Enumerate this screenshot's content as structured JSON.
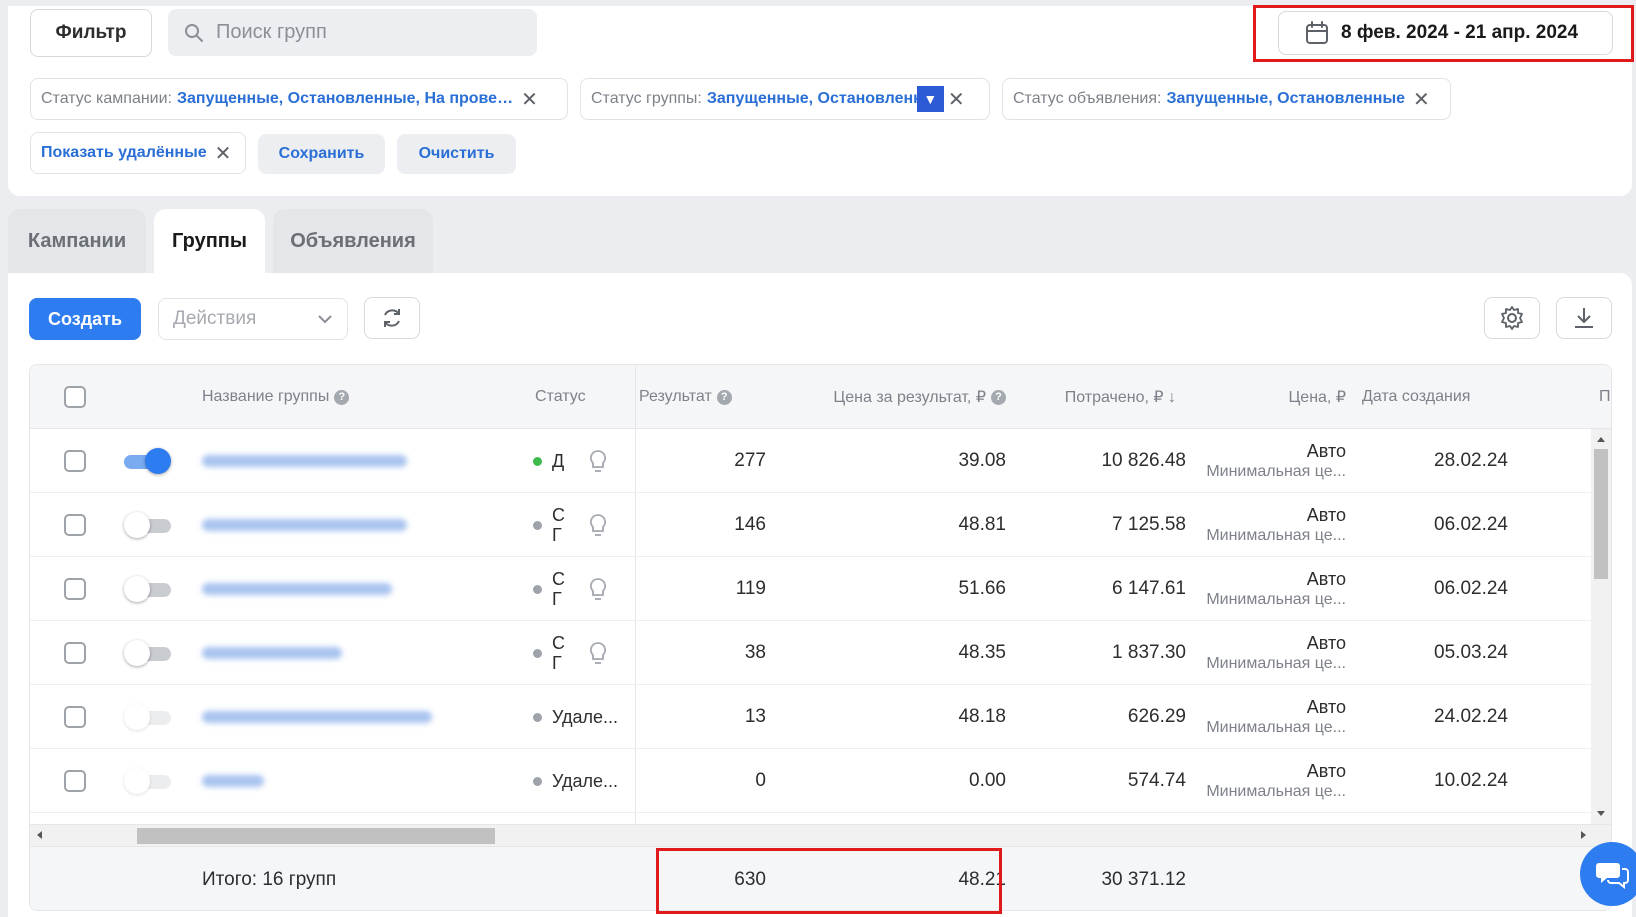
{
  "toolbar": {
    "filter_label": "Фильтр",
    "search_placeholder": "Поиск групп",
    "date_range": "8 фев. 2024 - 21 апр. 2024"
  },
  "filters": {
    "campaign_status_key": "Статус кампании:",
    "campaign_status_value": "Запущенные, Остановленные, На прове…",
    "group_status_key": "Статус группы:",
    "group_status_value": "Запущенные, Остановленн",
    "ad_status_key": "Статус объявления:",
    "ad_status_value": "Запущенные, Остановленные",
    "show_deleted": "Показать удалённые",
    "save": "Сохранить",
    "clear": "Очистить"
  },
  "tabs": [
    {
      "label": "Кампании",
      "active": false
    },
    {
      "label": "Группы",
      "active": true
    },
    {
      "label": "Объявления",
      "active": false
    }
  ],
  "actions_bar": {
    "create": "Создать",
    "actions_placeholder": "Действия"
  },
  "table": {
    "columns": {
      "name": "Название группы",
      "status": "Статус",
      "result": "Результат",
      "price_per_result": "Цена за результат, ₽",
      "spent": "Потрачено, ₽ ↓",
      "price": "Цена, ₽",
      "created": "Дата создания",
      "cut": "П"
    },
    "rows": [
      {
        "enabled": true,
        "status": "Д",
        "status2": "",
        "result": "277",
        "ppr": "39.08",
        "spent": "10 826.48",
        "price_main": "Авто",
        "price_sub": "Минимальная це...",
        "created": "28.02.24"
      },
      {
        "enabled": false,
        "status": "С",
        "status2": "Г",
        "result": "146",
        "ppr": "48.81",
        "spent": "7 125.58",
        "price_main": "Авто",
        "price_sub": "Минимальная це...",
        "created": "06.02.24"
      },
      {
        "enabled": false,
        "status": "С",
        "status2": "Г",
        "result": "119",
        "ppr": "51.66",
        "spent": "6 147.61",
        "price_main": "Авто",
        "price_sub": "Минимальная це...",
        "created": "06.02.24"
      },
      {
        "enabled": false,
        "status": "С",
        "status2": "Г",
        "result": "38",
        "ppr": "48.35",
        "spent": "1 837.30",
        "price_main": "Авто",
        "price_sub": "Минимальная це...",
        "created": "05.03.24"
      },
      {
        "enabled": false,
        "status": "Удале...",
        "status2": "",
        "result": "13",
        "ppr": "48.18",
        "spent": "626.29",
        "price_main": "Авто",
        "price_sub": "Минимальная це...",
        "created": "24.02.24"
      },
      {
        "enabled": false,
        "status": "Удале...",
        "status2": "",
        "result": "0",
        "ppr": "0.00",
        "spent": "574.74",
        "price_main": "Авто",
        "price_sub": "Минимальная це...",
        "created": "10.02.24"
      }
    ],
    "totals": {
      "label": "Итого: 16 групп",
      "result": "630",
      "ppr": "48.21",
      "spent": "30 371.12"
    }
  },
  "colors": {
    "accent": "#2d7cf0",
    "link": "#2a6fd6",
    "highlight": "#e01a1a"
  }
}
